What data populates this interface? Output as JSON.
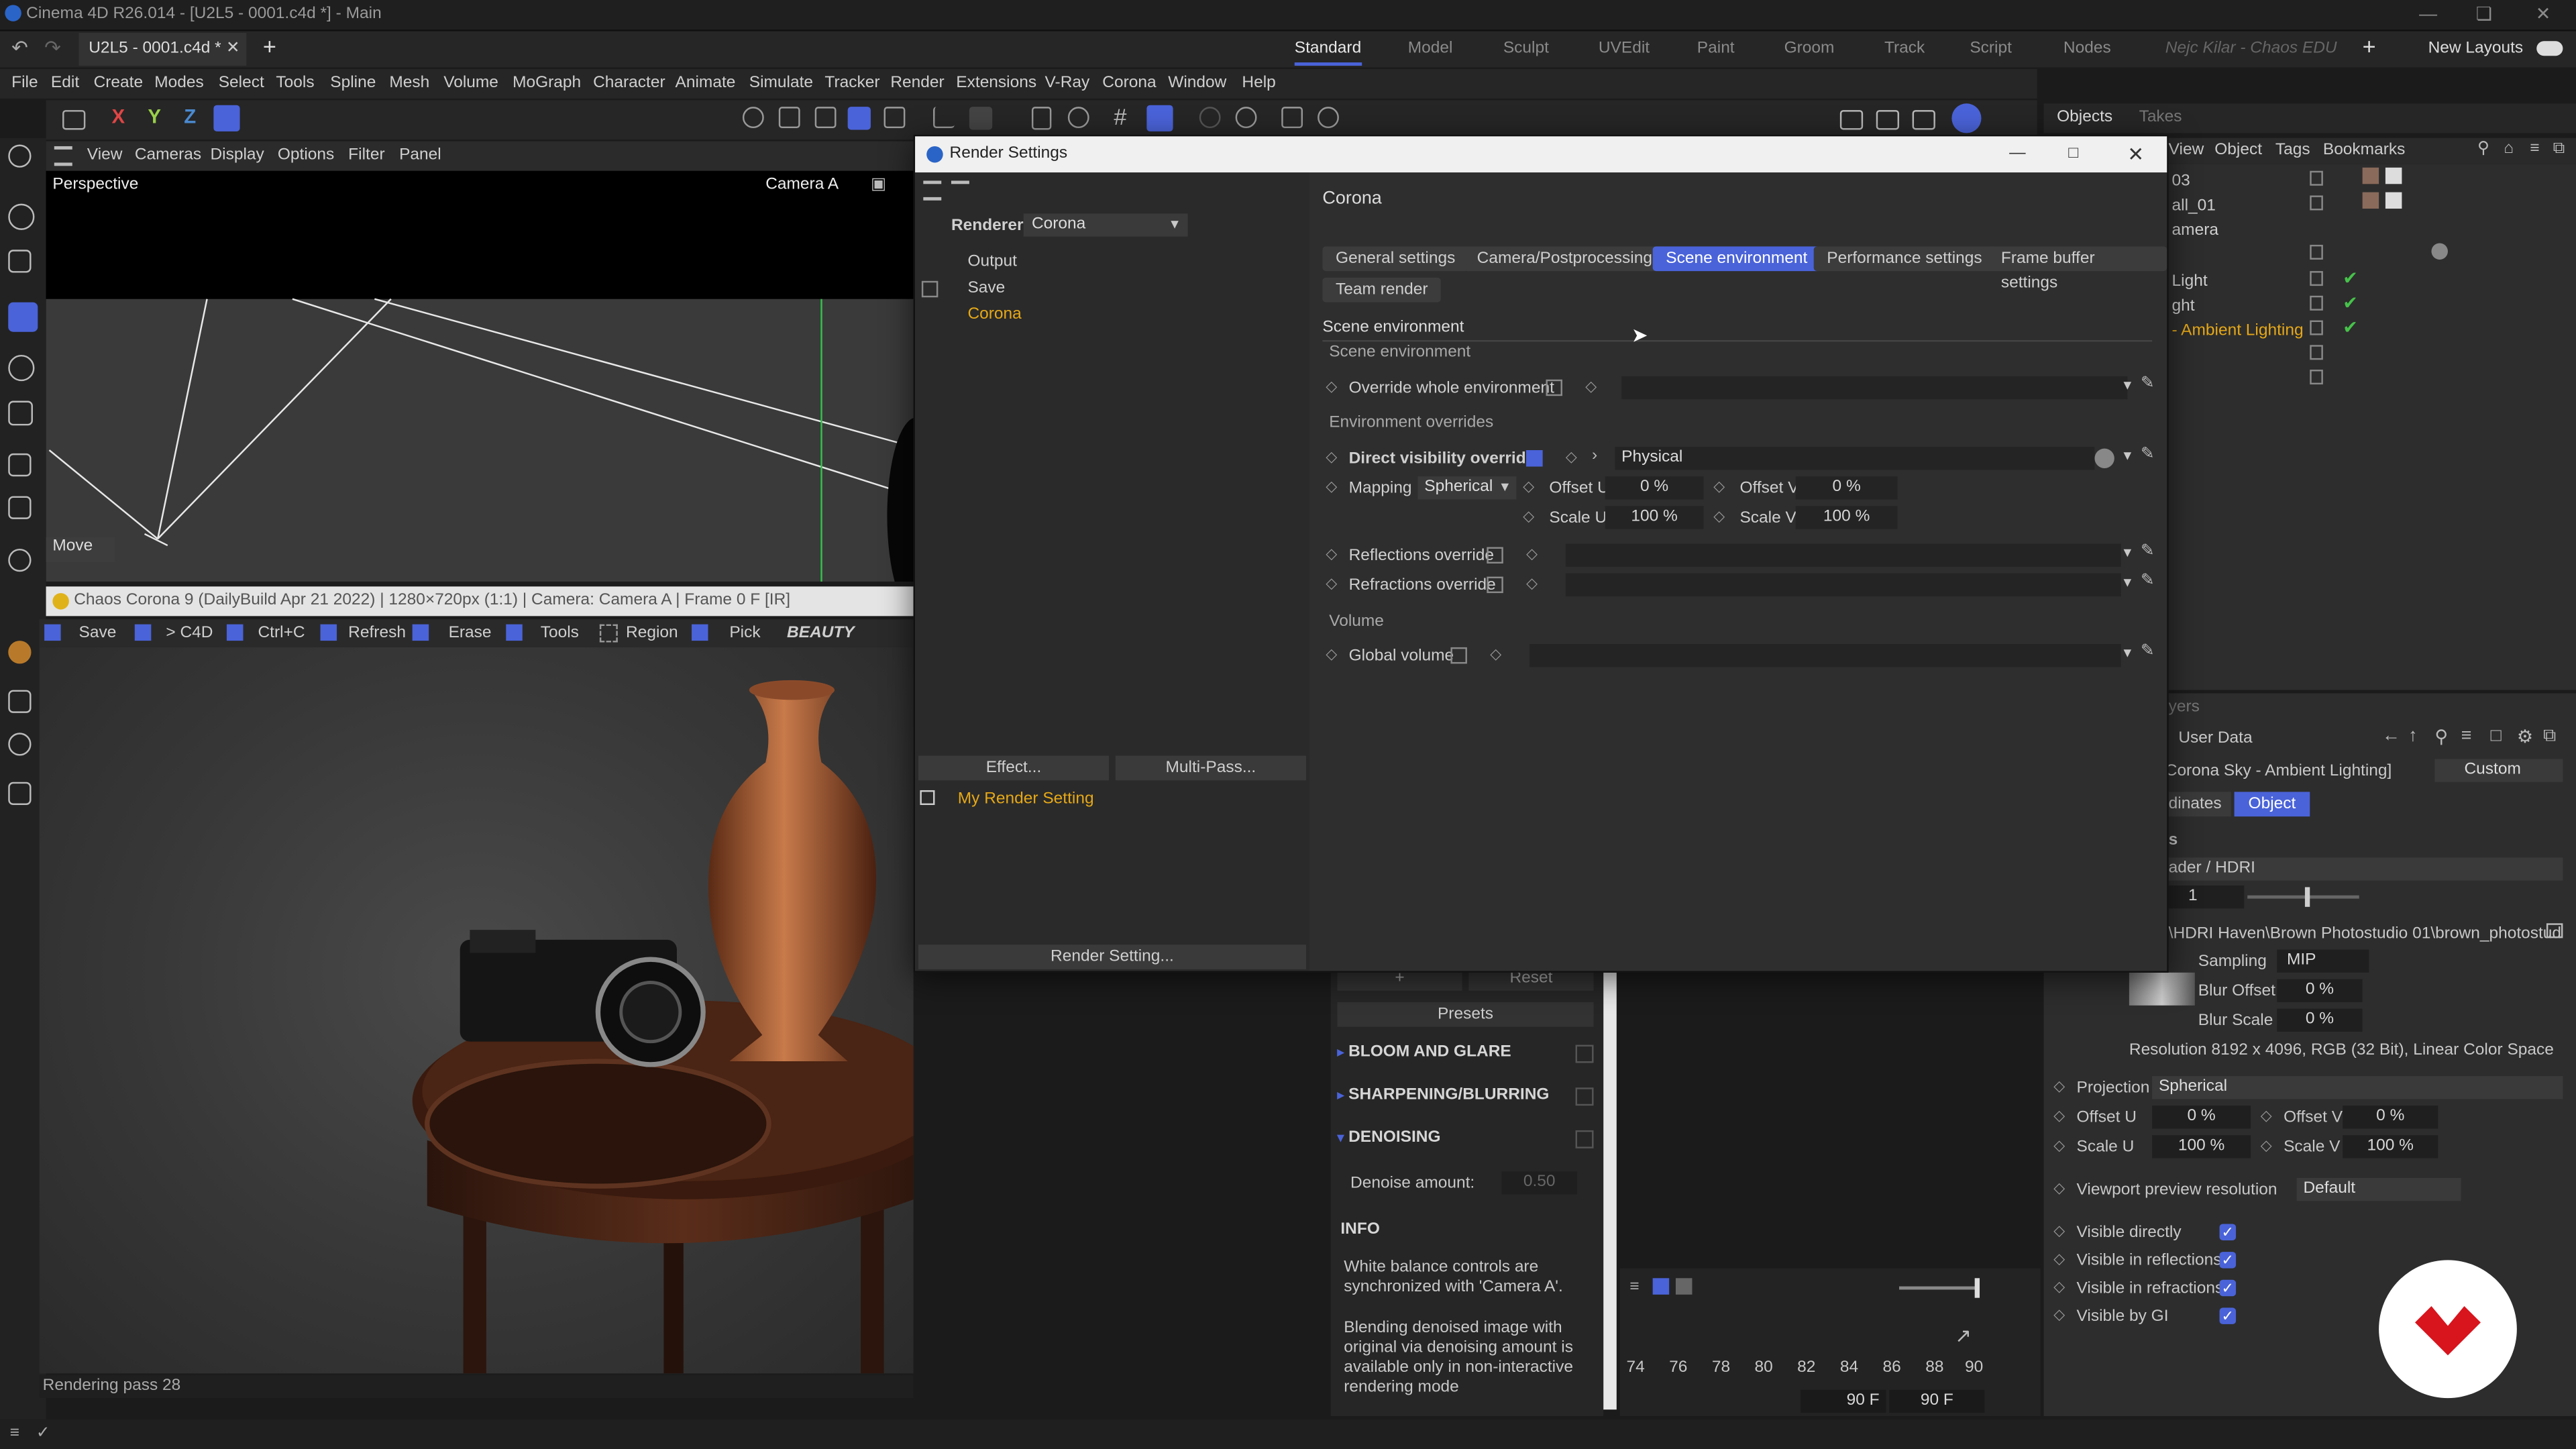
{
  "window": {
    "title": "Cinema 4D R26.014 - [U2L5 - 0001.c4d *] - Main"
  },
  "doc_tab": {
    "label": "U2L5 - 0001.c4d *"
  },
  "layouts": {
    "items": [
      "Standard",
      "Model",
      "Sculpt",
      "UVEdit",
      "Paint",
      "Groom",
      "Track",
      "Script",
      "Nodes"
    ],
    "user": "Nejc Kilar - Chaos EDU",
    "new_layouts": "New Layouts"
  },
  "menubar": {
    "items": [
      "File",
      "Edit",
      "Create",
      "Modes",
      "Select",
      "Tools",
      "Spline",
      "Mesh",
      "Volume",
      "MoGraph",
      "Character",
      "Animate",
      "Simulate",
      "Tracker",
      "Render",
      "Extensions",
      "V-Ray",
      "Corona",
      "Window",
      "Help"
    ]
  },
  "viewport": {
    "menu": [
      "View",
      "Cameras",
      "Display",
      "Options",
      "Filter",
      "Panel"
    ],
    "label": "Perspective",
    "camera": "Camera A",
    "tool": "Move"
  },
  "irw": {
    "title": "Chaos Corona 9 (DailyBuild Apr 21 2022) | 1280×720px (1:1) | Camera: Camera A | Frame 0 F [IR]",
    "tools": [
      "Save",
      "> C4D",
      "Ctrl+C",
      "Refresh",
      "Erase",
      "Tools",
      "Region",
      "Pick"
    ],
    "pass": "BEAUTY",
    "status": "Rendering pass 28"
  },
  "objects_panel": {
    "tabs": [
      "Objects",
      "Takes"
    ],
    "menu": [
      "View",
      "Object",
      "Tags",
      "Bookmarks"
    ],
    "rows": [
      "03",
      "all_01",
      "amera",
      "",
      "Light",
      "ght",
      "- Ambient Lighting",
      "",
      ""
    ],
    "highlight_row": "- Ambient Lighting"
  },
  "attributes": {
    "layers": "yers",
    "user_data": "User Data",
    "object_name": "Corona Sky - Ambient Lighting]",
    "mode": "Custom",
    "tabs": [
      "dinates",
      "Object"
    ],
    "section_s": "s",
    "shader": "ader / HDRI",
    "shader_value": "1",
    "path": "\\HDRI Haven\\Brown Photostudio 01\\brown_photostud",
    "sampling_label": "Sampling",
    "sampling_value": "MIP",
    "blur_offset_label": "Blur Offset",
    "blur_offset_value": "0 %",
    "blur_scale_label": "Blur Scale",
    "blur_scale_value": "0 %",
    "resolution": "Resolution 8192 x 4096, RGB (32 Bit), Linear Color Space",
    "projection_label": "Projection",
    "projection_value": "Spherical",
    "offset_u_label": "Offset U",
    "offset_u_value": "0 %",
    "offset_v_label": "Offset V",
    "offset_v_value": "0 %",
    "scale_u_label": "Scale U",
    "scale_u_value": "100 %",
    "scale_v_label": "Scale V",
    "scale_v_value": "100 %",
    "vp_res_label": "Viewport preview resolution",
    "vp_res_value": "Default",
    "visible": [
      "Visible directly",
      "Visible in reflections",
      "Visible in refractions",
      "Visible by GI"
    ]
  },
  "post": {
    "plus": "+",
    "reset": "Reset",
    "presets": "Presets",
    "sections": [
      "BLOOM AND GLARE",
      "SHARPENING/BLURRING",
      "DENOISING"
    ],
    "denoise_label": "Denoise amount:",
    "denoise_value": "0.50",
    "info_title": "INFO",
    "info1": "White balance controls are synchronized with 'Camera A'.",
    "info2": "Blending denoised image with original via denoising amount is available only in non-interactive rendering mode"
  },
  "timeline": {
    "ticks": [
      "74",
      "76",
      "78",
      "80",
      "82",
      "84",
      "86",
      "88",
      "90"
    ],
    "end1": "90 F",
    "end2": "90 F"
  },
  "render_settings": {
    "title": "Render Settings",
    "renderer_label": "Renderer",
    "renderer_value": "Corona",
    "tree": [
      "Output",
      "Save",
      "Corona"
    ],
    "effect_btn": "Effect...",
    "multipass_btn": "Multi-Pass...",
    "preset": "My Render Setting",
    "footer_btn": "Render Setting...",
    "header": "Corona",
    "tabs": [
      "General settings",
      "Camera/Postprocessing",
      "Scene environment",
      "Performance settings",
      "Frame buffer settings",
      "Team render"
    ],
    "active_tab": "Scene environment",
    "section": "Scene environment",
    "sub_scene": "Scene environment",
    "override_whole": "Override whole environment",
    "env_overrides": "Environment overrides",
    "direct_vis": "Direct visibility override",
    "direct_vis_value": "Physical",
    "mapping_label": "Mapping",
    "mapping_value": "Spherical",
    "offset_u_label": "Offset U",
    "offset_u_value": "0 %",
    "offset_v_label": "Offset V",
    "offset_v_value": "0 %",
    "scale_u_label": "Scale U",
    "scale_u_value": "100 %",
    "scale_v_label": "Scale V",
    "scale_v_value": "100 %",
    "reflections": "Reflections override",
    "refractions": "Refractions override",
    "volume": "Volume",
    "global_volume": "Global volume"
  },
  "colors": {
    "accent": "#4a63d9",
    "highlight": "#e6a817",
    "logo_red": "#d8141d",
    "check_green": "#46c24a"
  }
}
